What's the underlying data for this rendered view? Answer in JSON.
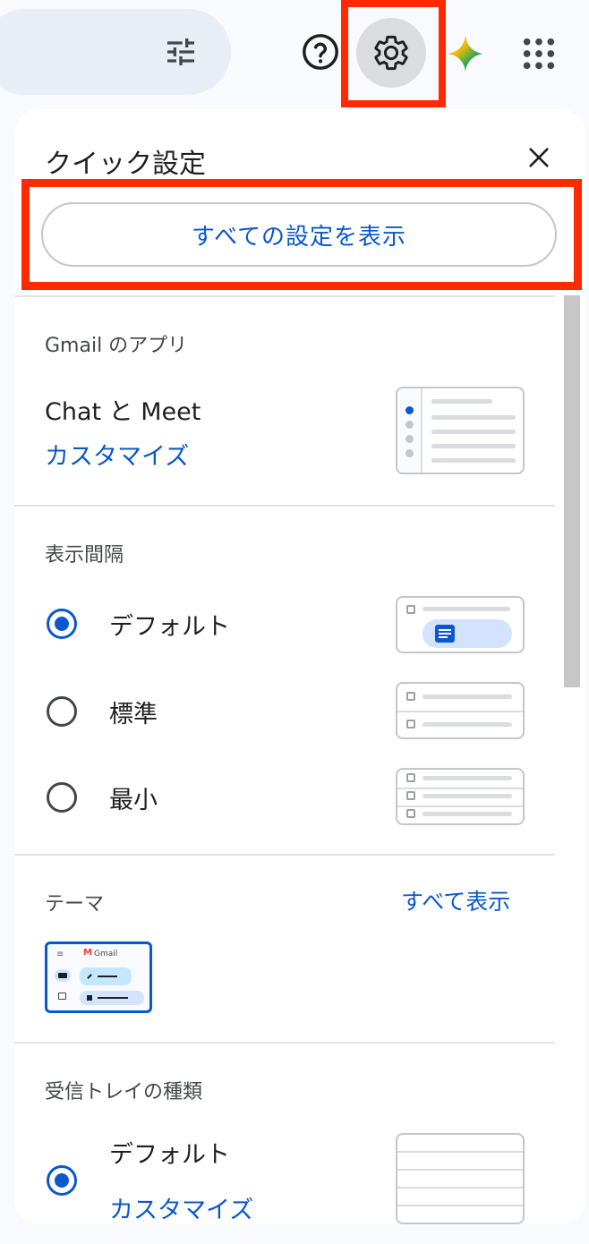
{
  "header": {
    "icons": [
      "filter-icon",
      "help-icon",
      "gear-icon",
      "gemini-icon",
      "apps-icon"
    ]
  },
  "panel": {
    "title": "クイック設定",
    "all_settings_label": "すべての設定を表示"
  },
  "apps_section": {
    "heading": "Gmail のアプリ",
    "item_label": "Chat と Meet",
    "customize_label": "カスタマイズ"
  },
  "density_section": {
    "heading": "表示間隔",
    "options": [
      {
        "label": "デフォルト",
        "selected": true
      },
      {
        "label": "標準",
        "selected": false
      },
      {
        "label": "最小",
        "selected": false
      }
    ]
  },
  "theme_section": {
    "heading": "テーマ",
    "show_all_label": "すべて表示",
    "preview_brand": "Gmail"
  },
  "inbox_section": {
    "heading": "受信トレイの種類",
    "option_label": "デフォルト",
    "option_selected": true,
    "customize_label": "カスタマイズ"
  },
  "colors": {
    "accent": "#0b57d0",
    "highlight": "#ff2a00"
  }
}
